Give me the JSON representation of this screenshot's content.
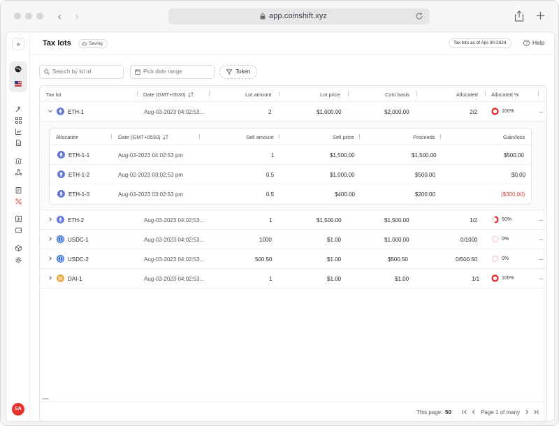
{
  "browser": {
    "url": "app.coinshift.xyz"
  },
  "header": {
    "title": "Tax lots",
    "saving": "Saving",
    "as_of": "Tax lots as of Apr-30-2024",
    "help": "Help"
  },
  "sidebar": {
    "expand": "»",
    "avatar": "SA",
    "icons": [
      "globe-icon",
      "flag-icon",
      "magic-icon",
      "grid-icon",
      "chart-icon",
      "document-icon",
      "bank-icon",
      "network-icon",
      "ledger-icon",
      "percent-icon",
      "report-icon",
      "wallet-icon",
      "cube-icon",
      "settings-icon"
    ]
  },
  "filters": {
    "search_placeholder": "Search by lot id",
    "date_placeholder": "Pick date range",
    "token_label": "Token"
  },
  "table": {
    "columns": {
      "lot": "Tax lot",
      "date": "Date (GMT+0530)",
      "amount": "Lot amount",
      "price": "Lot price",
      "cost": "Cost basis",
      "allocated": "Allocated",
      "allocated_pct": "Allocated %"
    },
    "rows": [
      {
        "lot": "ETH-1",
        "date": "Aug-03-2023 04:02:53...",
        "amount": "2",
        "price": "$1,000.00",
        "cost": "$2,000.00",
        "allocated": "2/2",
        "pct": "100%",
        "pct_value": 1.0,
        "coin": "eth"
      },
      {
        "lot": "ETH-2",
        "date": "Aug-03-2023 04:02:53...",
        "amount": "1",
        "price": "$1,500.00",
        "cost": "$1,500.00",
        "allocated": "1/2",
        "pct": "50%",
        "pct_value": 0.5,
        "coin": "eth"
      },
      {
        "lot": "USDC-1",
        "date": "Aug-03-2023 04:02:53...",
        "amount": "1000",
        "price": "$1.00",
        "cost": "$1,000.00",
        "allocated": "0/1000",
        "pct": "0%",
        "pct_value": 0,
        "coin": "usdc"
      },
      {
        "lot": "USDC-2",
        "date": "Aug-03-2023 04:02:53...",
        "amount": "500.50",
        "price": "$1.00",
        "cost": "$500.50",
        "allocated": "0/500.50",
        "pct": "0%",
        "pct_value": 0,
        "coin": "usdc"
      },
      {
        "lot": "DAI-1",
        "date": "Aug-03-2023 04:02:53...",
        "amount": "1",
        "price": "$1.00",
        "cost": "$1.00",
        "allocated": "1/1",
        "pct": "100%",
        "pct_value": 1.0,
        "coin": "dai"
      }
    ],
    "more": "..."
  },
  "subtable": {
    "columns": {
      "allocation": "Allocation",
      "date": "Date (GMT+0530)",
      "sell_amount": "Sell amount",
      "sell_price": "Sell price",
      "proceeds": "Proceeds",
      "gain": "Gain/loss"
    },
    "rows": [
      {
        "allocation": "ETH-1-1",
        "date": "Aug-03-2023 04:02:53 pm",
        "sell_amount": "1",
        "sell_price": "$1,500.00",
        "proceeds": "$1,500.00",
        "gain": "$500.00"
      },
      {
        "allocation": "ETH-1-2",
        "date": "Aug-02-2023 03:02:53 pm",
        "sell_amount": "0.5",
        "sell_price": "$1,000.00",
        "proceeds": "$500.00",
        "gain": "$0.00"
      },
      {
        "allocation": "ETH-1-3",
        "date": "Aug-03-2023 03:02:53 pm",
        "sell_amount": "0.5",
        "sell_price": "$400.00",
        "proceeds": "$200.00",
        "gain": "($300.00)"
      }
    ]
  },
  "pagination": {
    "this_page_label": "This page:",
    "this_page_value": "50",
    "page_text": "Page 1 of many"
  },
  "colors": {
    "eth": "#6274d8",
    "usdc": "#2f6bd1",
    "dai": "#f1a53a",
    "ring": "#e5242b",
    "avatar": "#e7322b"
  }
}
